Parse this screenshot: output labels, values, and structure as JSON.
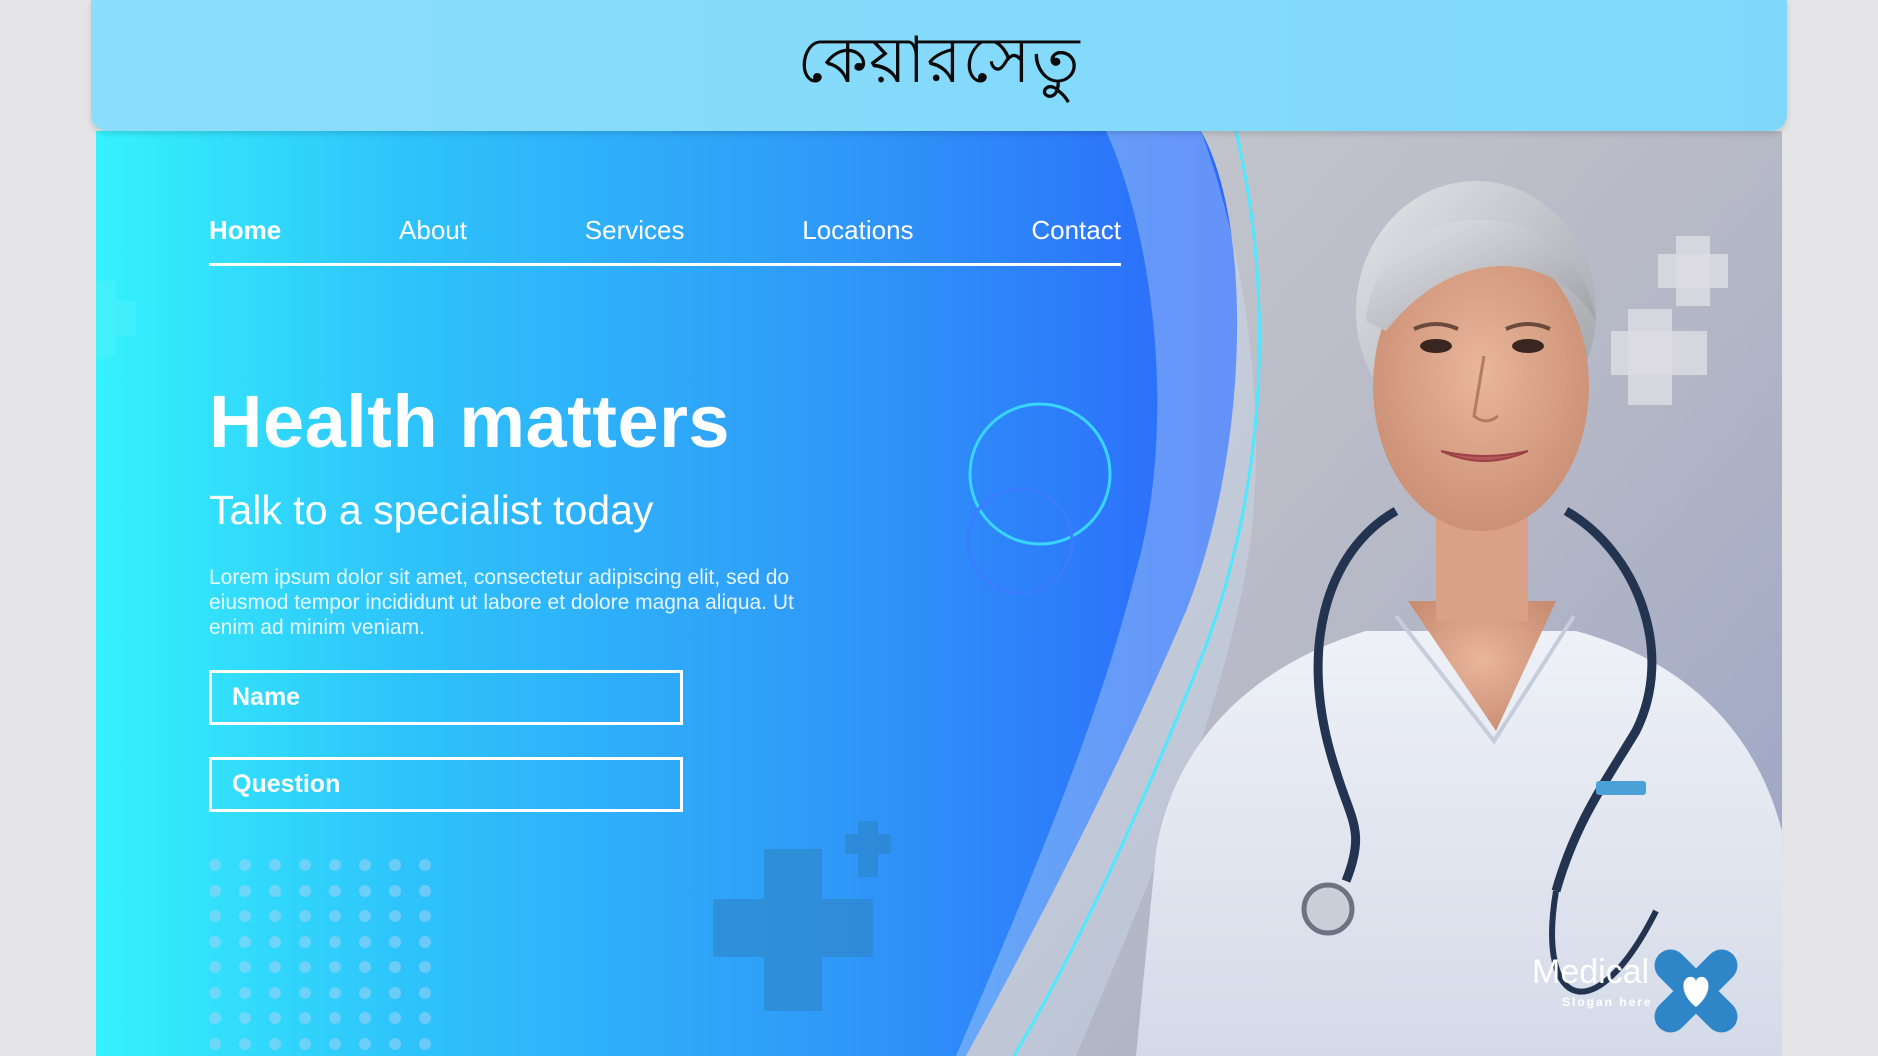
{
  "header": {
    "title": "কেয়ারসেতু"
  },
  "nav": {
    "items": [
      {
        "label": "Home",
        "active": true
      },
      {
        "label": "About"
      },
      {
        "label": "Services"
      },
      {
        "label": "Locations"
      },
      {
        "label": "Contact"
      }
    ]
  },
  "hero": {
    "headline": "Health matters",
    "subhead": "Talk to a specialist today",
    "body": "Lorem ipsum dolor sit amet, consectetur adipiscing elit, sed do eiusmod tempor incididunt ut labore et dolore magna aliqua. Ut enim ad minim veniam."
  },
  "form": {
    "name_placeholder": "Name",
    "question_placeholder": "Question"
  },
  "logo": {
    "name": "Medical",
    "slogan": "Slogan here"
  },
  "colors": {
    "topbar": "#8bddfb",
    "gradient_start": "#35f2fb",
    "gradient_end": "#2a48fb",
    "accent_cross": "#2e86c9"
  }
}
